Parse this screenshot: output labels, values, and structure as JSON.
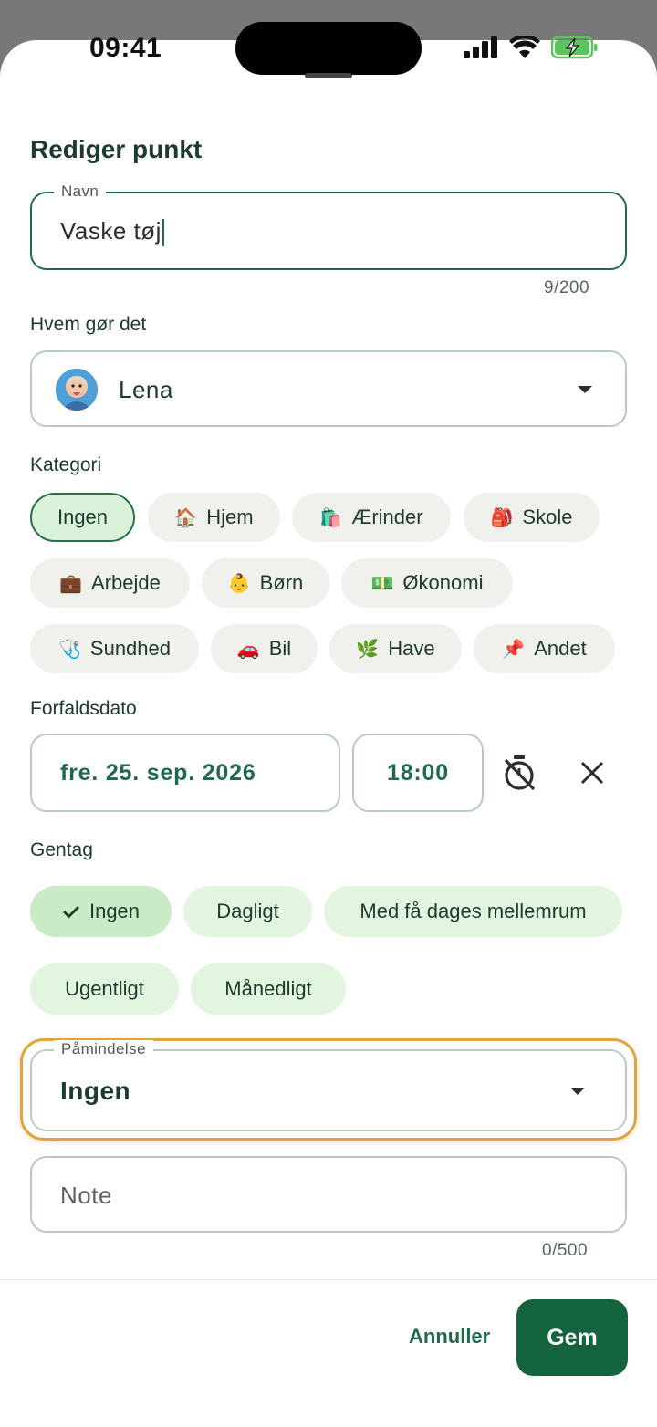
{
  "status_bar": {
    "time": "09:41"
  },
  "dialog": {
    "title": "Rediger punkt"
  },
  "name_field": {
    "label": "Navn",
    "value": "Vaske tøj",
    "counter": "9/200"
  },
  "assignee": {
    "label": "Hvem gør det",
    "value": "Lena"
  },
  "category": {
    "label": "Kategori",
    "chips": [
      {
        "emoji": "",
        "label": "Ingen",
        "selected": true
      },
      {
        "emoji": "🏠",
        "label": "Hjem"
      },
      {
        "emoji": "🛍️",
        "label": "Ærinder"
      },
      {
        "emoji": "🎒",
        "label": "Skole"
      },
      {
        "emoji": "💼",
        "label": "Arbejde"
      },
      {
        "emoji": "👶",
        "label": "Børn"
      },
      {
        "emoji": "💵",
        "label": "Økonomi"
      },
      {
        "emoji": "🩺",
        "label": "Sundhed"
      },
      {
        "emoji": "🚗",
        "label": "Bil"
      },
      {
        "emoji": "🌿",
        "label": "Have"
      },
      {
        "emoji": "📌",
        "label": "Andet"
      }
    ]
  },
  "due": {
    "label": "Forfaldsdato",
    "date": "fre. 25. sep. 2026",
    "time": "18:00"
  },
  "repeat": {
    "label": "Gentag",
    "options": [
      {
        "label": "Ingen",
        "selected": true
      },
      {
        "label": "Dagligt"
      },
      {
        "label": "Med få dages mellemrum"
      },
      {
        "label": "Ugentligt"
      },
      {
        "label": "Månedligt"
      }
    ]
  },
  "reminder": {
    "label": "Påmindelse",
    "value": "Ingen"
  },
  "note": {
    "placeholder": "Note",
    "counter": "0/500"
  },
  "actions": {
    "cancel": "Annuller",
    "save": "Gem"
  },
  "colors": {
    "accent": "#14633f",
    "selected_chip": "#d9f2d9",
    "highlight": "#e0a33d"
  }
}
